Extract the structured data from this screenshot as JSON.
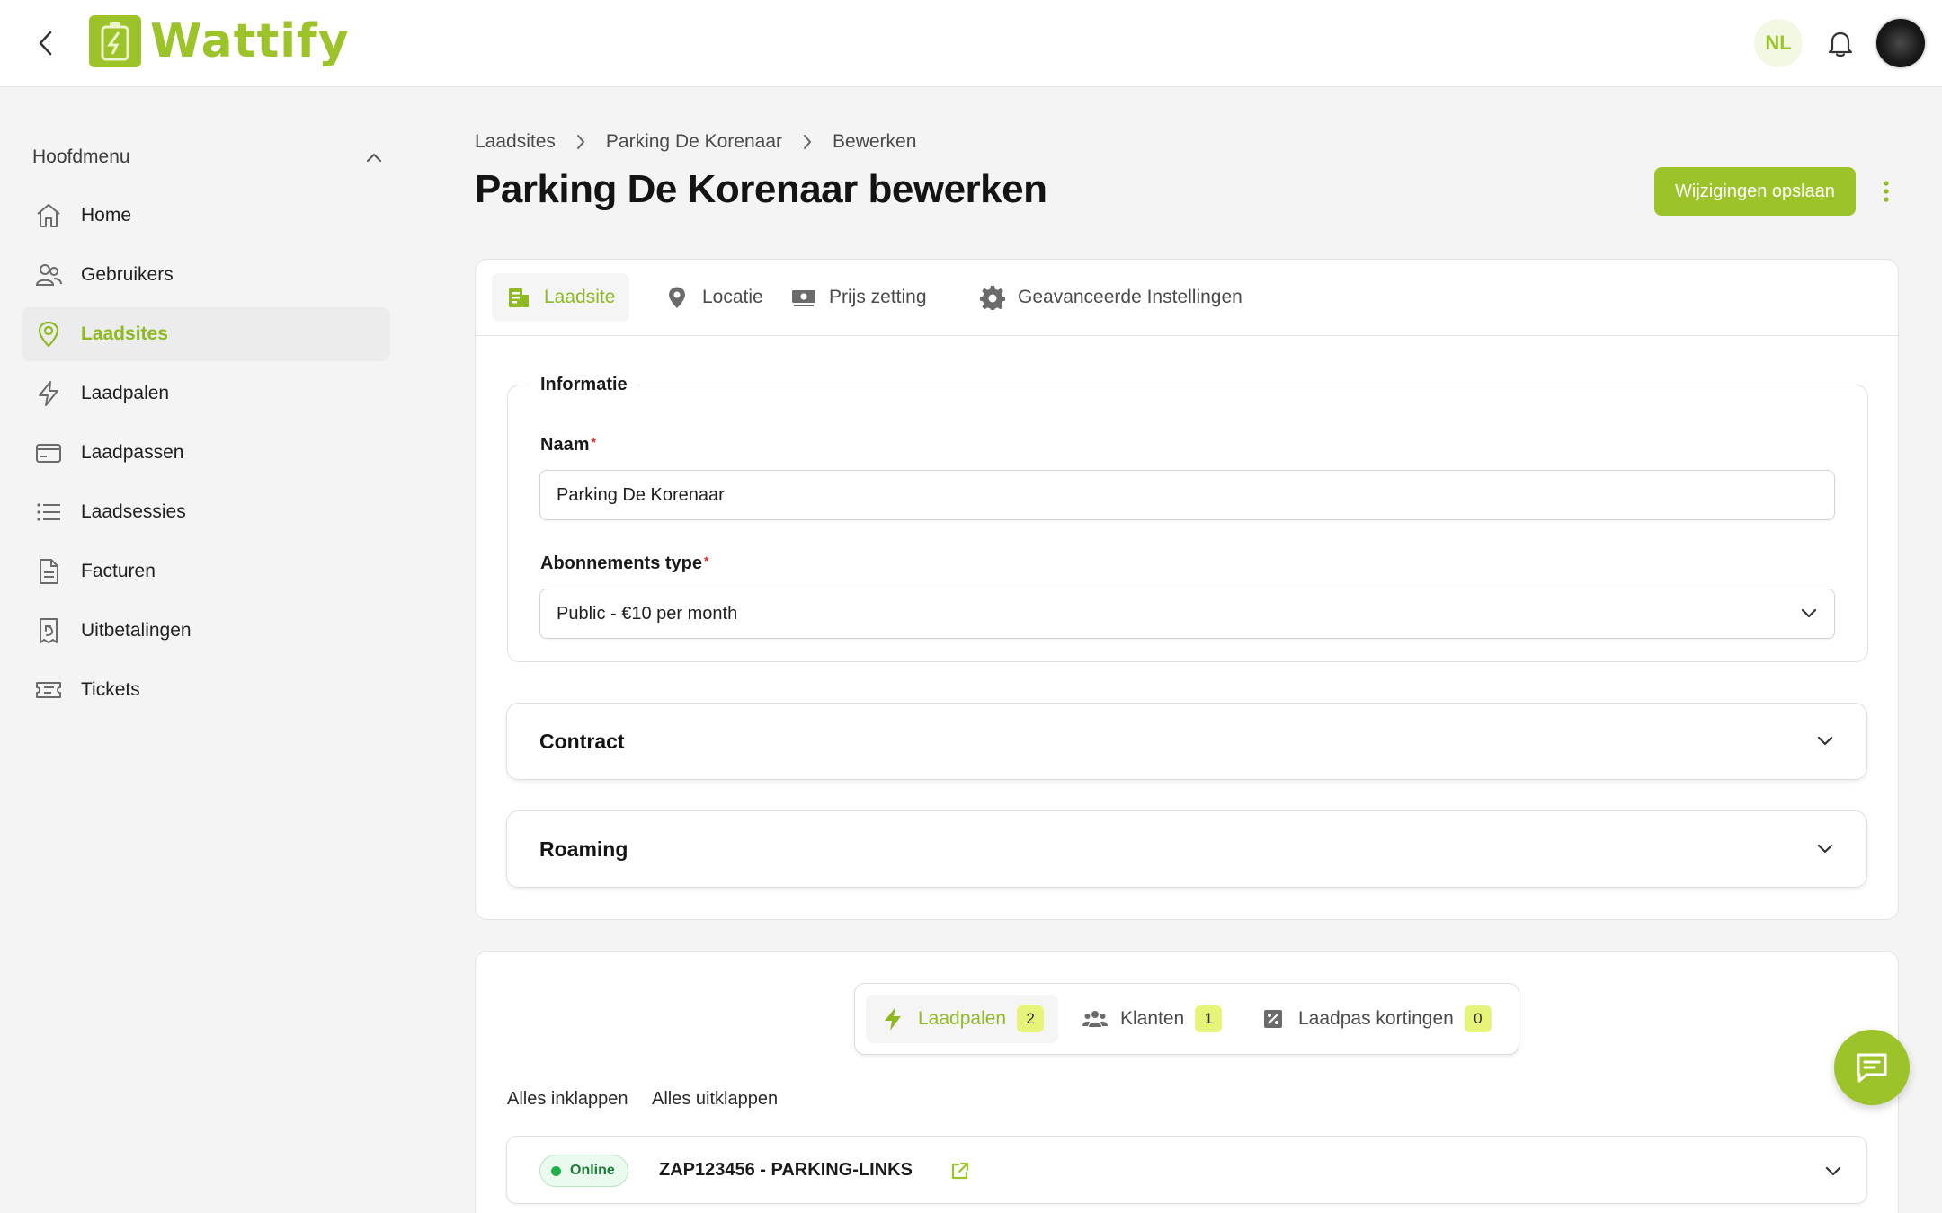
{
  "brand": {
    "name": "Wattify",
    "accent": "#9cc42a"
  },
  "header": {
    "language": "NL"
  },
  "sidebar": {
    "title": "Hoofdmenu",
    "items": [
      {
        "label": "Home",
        "icon": "home-icon"
      },
      {
        "label": "Gebruikers",
        "icon": "users-icon"
      },
      {
        "label": "Laadsites",
        "icon": "map-pin-icon",
        "active": true
      },
      {
        "label": "Laadpalen",
        "icon": "lightning-icon"
      },
      {
        "label": "Laadpassen",
        "icon": "card-icon"
      },
      {
        "label": "Laadsessies",
        "icon": "list-icon"
      },
      {
        "label": "Facturen",
        "icon": "document-icon"
      },
      {
        "label": "Uitbetalingen",
        "icon": "receipt-icon"
      },
      {
        "label": "Tickets",
        "icon": "ticket-icon"
      }
    ]
  },
  "breadcrumb": [
    "Laadsites",
    "Parking De Korenaar",
    "Bewerken"
  ],
  "page": {
    "title": "Parking De Korenaar bewerken",
    "save_label": "Wijzigingen opslaan"
  },
  "tabs": [
    {
      "label": "Laadsite",
      "icon": "building-icon",
      "active": true
    },
    {
      "label": "Locatie",
      "icon": "location-icon"
    },
    {
      "label": "Prijs zetting",
      "icon": "money-icon"
    },
    {
      "label": "Geavanceerde Instellingen",
      "icon": "gear-icon"
    }
  ],
  "form": {
    "section_title": "Informatie",
    "name_label": "Naam",
    "name_value": "Parking De Korenaar",
    "subscription_label": "Abonnements type",
    "subscription_value": "Public - €10 per month",
    "required_mark": "*"
  },
  "accordions": [
    {
      "title": "Contract"
    },
    {
      "title": "Roaming"
    }
  ],
  "segments": [
    {
      "label": "Laadpalen",
      "count": "2",
      "icon": "lightning-icon",
      "active": true
    },
    {
      "label": "Klanten",
      "count": "1",
      "icon": "users-icon"
    },
    {
      "label": "Laadpas kortingen",
      "count": "0",
      "icon": "discount-icon"
    }
  ],
  "list_controls": {
    "collapse_all": "Alles inklappen",
    "expand_all": "Alles uitklappen"
  },
  "chargers": [
    {
      "status": "Online",
      "name": "ZAP123456 - PARKING-LINKS"
    }
  ]
}
